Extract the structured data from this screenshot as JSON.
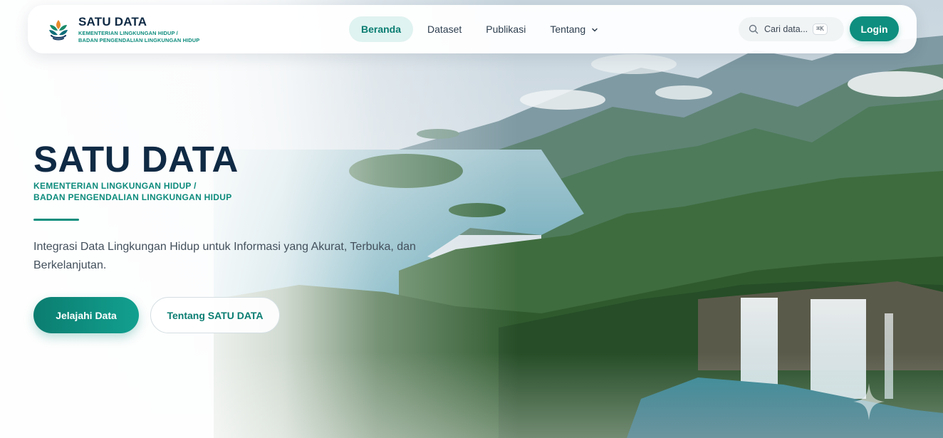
{
  "navbar": {
    "brand_title": "SATU DATA",
    "brand_sub_line1": "KEMENTERIAN LINGKUNGAN HIDUP /",
    "brand_sub_line2": "BADAN PENGENDALIAN LINGKUNGAN HIDUP",
    "links": [
      {
        "label": "Beranda",
        "active": true
      },
      {
        "label": "Dataset",
        "active": false
      },
      {
        "label": "Publikasi",
        "active": false
      },
      {
        "label": "Tentang",
        "active": false,
        "has_dropdown": true
      }
    ],
    "search_placeholder": "Cari data...",
    "search_shortcut": "⌘K",
    "login_label": "Login"
  },
  "hero": {
    "title": "SATU DATA",
    "sub_line1": "KEMENTERIAN LINGKUNGAN HIDUP /",
    "sub_line2": "BADAN PENGENDALIAN LINGKUNGAN HIDUP",
    "description": "Integrasi Data Lingkungan Hidup untuk Informasi yang Akurat, Terbuka, dan Berkelanjutan.",
    "primary_button": "Jelajahi Data",
    "secondary_button": "Tentang SATU DATA"
  },
  "colors": {
    "brand_navy": "#0f2a44",
    "brand_teal": "#0d8e7e",
    "active_nav_bg": "#dff3f0"
  },
  "icons": {
    "logo": "leaf-emblem-icon",
    "search": "search-icon",
    "dropdown": "chevron-down-icon",
    "sparkle": "sparkle-icon"
  }
}
